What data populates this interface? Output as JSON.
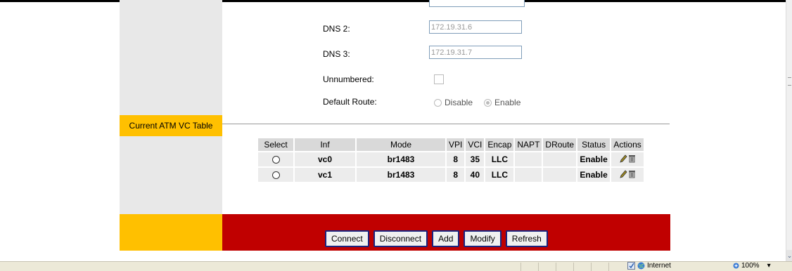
{
  "form": {
    "dns2_label": "DNS 2:",
    "dns2_value": "172.19.31.6",
    "dns3_label": "DNS 3:",
    "dns3_value": "172.19.31.7",
    "unnumbered_label": "Unnumbered:",
    "unnumbered_checked": false,
    "default_route_label": "Default Route:",
    "default_route_options": [
      "Disable",
      "Enable"
    ],
    "default_route_selected": "Enable"
  },
  "section": {
    "title": "Current ATM VC Table"
  },
  "table": {
    "headers": [
      "Select",
      "Inf",
      "Mode",
      "VPI",
      "VCI",
      "Encap",
      "NAPT",
      "DRoute",
      "Status",
      "Actions"
    ],
    "rows": [
      {
        "inf": "vc0",
        "mode": "br1483",
        "vpi": "8",
        "vci": "35",
        "encap": "LLC",
        "napt": "",
        "droute": "",
        "status": "Enable"
      },
      {
        "inf": "vc1",
        "mode": "br1483",
        "vpi": "8",
        "vci": "40",
        "encap": "LLC",
        "napt": "",
        "droute": "",
        "status": "Enable"
      }
    ]
  },
  "buttons": {
    "connect": "Connect",
    "disconnect": "Disconnect",
    "add": "Add",
    "modify": "Modify",
    "refresh": "Refresh"
  },
  "statusbar": {
    "zone": "Internet",
    "zoom": "100%"
  },
  "colors": {
    "accent_yellow": "#ffc000",
    "footer_red": "#c00000",
    "side_gray": "#e8e8e8"
  }
}
